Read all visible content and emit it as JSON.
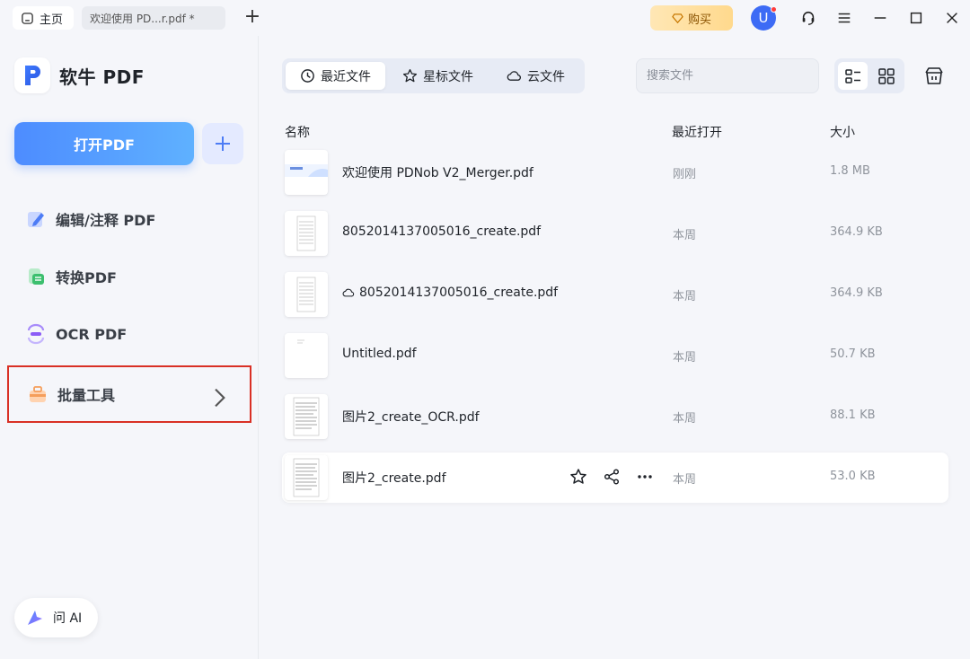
{
  "titlebar": {
    "home_tab": "主页",
    "doc_tab": "欢迎使用 PD...r.pdf *",
    "buy_label": "购买",
    "avatar_letter": "U"
  },
  "sidebar": {
    "brand": "软牛 PDF",
    "open_button": "打开PDF",
    "items": [
      {
        "label": "编辑/注释 PDF",
        "icon": "edit-annotate-icon"
      },
      {
        "label": "转换PDF",
        "icon": "convert-icon"
      },
      {
        "label": "OCR PDF",
        "icon": "ocr-icon"
      },
      {
        "label": "批量工具",
        "icon": "batch-toolbox-icon"
      }
    ],
    "ai_button": "问 AI"
  },
  "main": {
    "tabs": [
      {
        "label": "最近文件",
        "icon": "clock-icon",
        "active": true
      },
      {
        "label": "星标文件",
        "icon": "star-icon",
        "active": false
      },
      {
        "label": "云文件",
        "icon": "cloud-icon",
        "active": false
      }
    ],
    "search_placeholder": "搜索文件",
    "columns": {
      "name": "名称",
      "opened": "最近打开",
      "size": "大小"
    },
    "files": [
      {
        "name": "欢迎使用 PDNob V2_Merger.pdf",
        "opened": "刚刚",
        "size": "1.8 MB",
        "cloud": false
      },
      {
        "name": "8052014137005016_create.pdf",
        "opened": "本周",
        "size": "364.9 KB",
        "cloud": false
      },
      {
        "name": "8052014137005016_create.pdf",
        "opened": "本周",
        "size": "364.9 KB",
        "cloud": true
      },
      {
        "name": "Untitled.pdf",
        "opened": "本周",
        "size": "50.7 KB",
        "cloud": false
      },
      {
        "name": "图片2_create_OCR.pdf",
        "opened": "本周",
        "size": "88.1 KB",
        "cloud": false
      },
      {
        "name": "图片2_create.pdf",
        "opened": "本周",
        "size": "53.0 KB",
        "cloud": false
      }
    ]
  },
  "colors": {
    "accent": "#4d8cff",
    "selection_border": "#d93025",
    "avatar": "#3d6bf5",
    "buy_bg": "#ffe0a0"
  }
}
